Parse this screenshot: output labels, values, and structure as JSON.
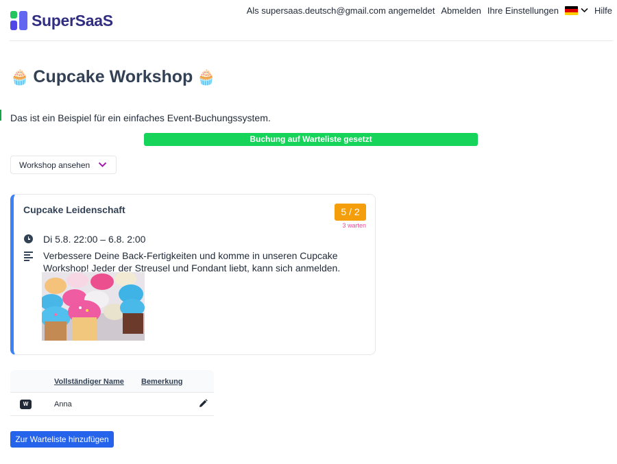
{
  "header": {
    "logo_text": "SuperSaaS",
    "login_status": "Als supersaas.deutsch@gmail.com angemeldet",
    "logout_label": "Abmelden",
    "settings_label": "Ihre Einstellungen",
    "language_icon": "german-flag-icon",
    "help_label": "Hilfe"
  },
  "page": {
    "title": "Cupcake Workshop",
    "title_icon": "cupcake-emoji",
    "intro": "Das ist ein Beispiel für ein einfaches Event-Buchungssystem.",
    "flash_message": "Buchung auf Warteliste gesetzt",
    "view_select_label": "Workshop ansehen"
  },
  "event": {
    "name": "Cupcake Leidenschaft",
    "capacity": "5 / 2",
    "waiting": "3 warten",
    "time": "Di 5.8.  22:00 – 6.8. 2:00",
    "description": "Verbessere Deine Back-Fertigkeiten und komme in unseren Cupcake Workshop! Jeder der Streusel und Fondant liebt, kann sich anmelden.",
    "image": "cupcakes-photo"
  },
  "waitlist": {
    "columns": [
      "Vollständiger Name",
      "Bemerkung"
    ],
    "rows": [
      {
        "badge": "W",
        "name": "Anna",
        "remark": ""
      }
    ],
    "add_button": "Zur Warteliste hinzufügen"
  },
  "colors": {
    "brand": "#312e81",
    "flash_bg": "#16d45a",
    "capacity_bg": "#f59e0b",
    "waiting_text": "#ec4899",
    "card_accent": "#3b82f6",
    "button_bg": "#2563eb"
  }
}
